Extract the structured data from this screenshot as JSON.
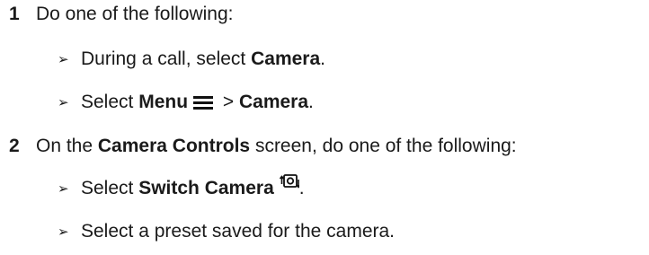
{
  "steps": [
    {
      "number": "1",
      "text": "Do one of the following:",
      "subitems": [
        {
          "pre": "During a call, select ",
          "bold": "Camera",
          "post": "."
        },
        {
          "pre": "Select ",
          "bold": "Menu",
          "mid": " > ",
          "bold2": "Camera",
          "post": ".",
          "icon": "menu-icon"
        }
      ]
    },
    {
      "number": "2",
      "pre": "On the ",
      "bold": "Camera Controls",
      "post": " screen, do one of the following:",
      "subitems": [
        {
          "pre": "Select ",
          "bold": "Switch Camera",
          "post": ".",
          "icon": "switch-camera-icon"
        },
        {
          "text": "Select a preset saved for the camera."
        }
      ]
    }
  ],
  "arrow_glyph": "➢"
}
